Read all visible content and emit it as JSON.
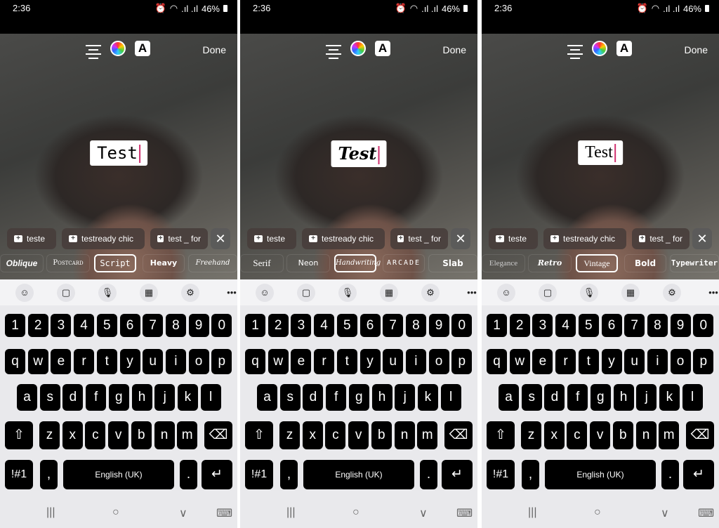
{
  "status": {
    "time": "2:36",
    "battery": "46%",
    "icons": [
      "alarm-icon",
      "wifi-icon",
      "signal-icon",
      "signal-icon",
      "battery-icon"
    ]
  },
  "toolbar": {
    "font_button": "A",
    "done": "Done"
  },
  "chips": [
    "teste",
    "testready chic",
    "test _ for"
  ],
  "close_chip": "✕",
  "keyboard": {
    "rows": [
      [
        "1",
        "2",
        "3",
        "4",
        "5",
        "6",
        "7",
        "8",
        "9",
        "0"
      ],
      [
        "q",
        "w",
        "e",
        "r",
        "t",
        "y",
        "u",
        "i",
        "o",
        "p"
      ],
      [
        "a",
        "s",
        "d",
        "f",
        "g",
        "h",
        "j",
        "k",
        "l"
      ],
      [
        "z",
        "x",
        "c",
        "v",
        "b",
        "n",
        "m"
      ]
    ],
    "symbols": "!#1",
    "comma": ",",
    "space": "English (UK)",
    "period": ".",
    "shift": "⇧",
    "backspace": "⌫",
    "enter": "↵"
  },
  "kb_toolbar": [
    "emoji-icon",
    "clipboard-icon",
    "microphone-icon",
    "keypad-icon",
    "settings-icon",
    "more-icon"
  ],
  "nav": {
    "recent": "|||",
    "home": "○",
    "back": "∨",
    "keyboard": "⌨"
  },
  "panels": [
    {
      "text": "Test",
      "fonts": [
        "Oblique",
        "Postcard",
        "Script",
        "Heavy",
        "Freehand"
      ],
      "selected": "Script"
    },
    {
      "text": "Test",
      "fonts": [
        "Serif",
        "Neon",
        "Handwriting",
        "ARCADE",
        "Slab"
      ],
      "selected": "Handwriting"
    },
    {
      "text": "Test",
      "fonts": [
        "Elegance",
        "Retro",
        "Vintage",
        "Bold",
        "Typewriter"
      ],
      "selected": "Vintage"
    }
  ]
}
